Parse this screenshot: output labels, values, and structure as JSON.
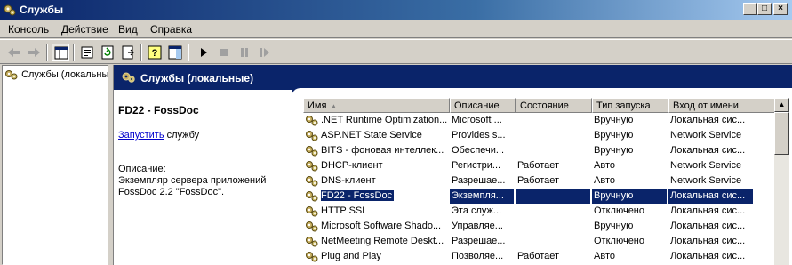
{
  "window": {
    "title": "Службы"
  },
  "menu": [
    {
      "label": "Консоль"
    },
    {
      "label": "Действие"
    },
    {
      "label": "Вид"
    },
    {
      "label": "Справка"
    }
  ],
  "tree": {
    "item_label": "Службы (локальные)"
  },
  "header": {
    "title": "Службы (локальные)"
  },
  "detail": {
    "service_title": "FD22 - FossDoc",
    "start_link": "Запустить",
    "start_suffix": " службу",
    "description_label": "Описание:",
    "description_text": "Экземпляр сервера приложений FossDoc 2.2 \"FossDoc\"."
  },
  "columns": [
    {
      "label": "Имя"
    },
    {
      "label": "Описание"
    },
    {
      "label": "Состояние"
    },
    {
      "label": "Тип запуска"
    },
    {
      "label": "Вход от имени"
    }
  ],
  "rows": [
    {
      "name": ".NET Runtime Optimization...",
      "description": "Microsoft ...",
      "state": "",
      "startup": "Вручную",
      "logon": "Локальная сис..."
    },
    {
      "name": "ASP.NET State Service",
      "description": "Provides s...",
      "state": "",
      "startup": "Вручную",
      "logon": "Network Service"
    },
    {
      "name": "BITS - фоновая интеллек...",
      "description": "Обеспечи...",
      "state": "",
      "startup": "Вручную",
      "logon": "Локальная сис..."
    },
    {
      "name": "DHCP-клиент",
      "description": "Регистри...",
      "state": "Работает",
      "startup": "Авто",
      "logon": "Network Service"
    },
    {
      "name": "DNS-клиент",
      "description": "Разрешае...",
      "state": "Работает",
      "startup": "Авто",
      "logon": "Network Service"
    },
    {
      "name": "FD22 - FossDoc",
      "description": "Экземпля...",
      "state": "",
      "startup": "Вручную",
      "logon": "Локальная сис...",
      "selected": true
    },
    {
      "name": "HTTP SSL",
      "description": "Эта служ...",
      "state": "",
      "startup": "Отключено",
      "logon": "Локальная сис..."
    },
    {
      "name": "Microsoft Software Shado...",
      "description": "Управляе...",
      "state": "",
      "startup": "Вручную",
      "logon": "Локальная сис..."
    },
    {
      "name": "NetMeeting Remote Deskt...",
      "description": "Разрешае...",
      "state": "",
      "startup": "Отключено",
      "logon": "Локальная сис..."
    },
    {
      "name": "Plug and Play",
      "description": "Позволяе...",
      "state": "Работает",
      "startup": "Авто",
      "logon": "Локальная сис..."
    }
  ]
}
